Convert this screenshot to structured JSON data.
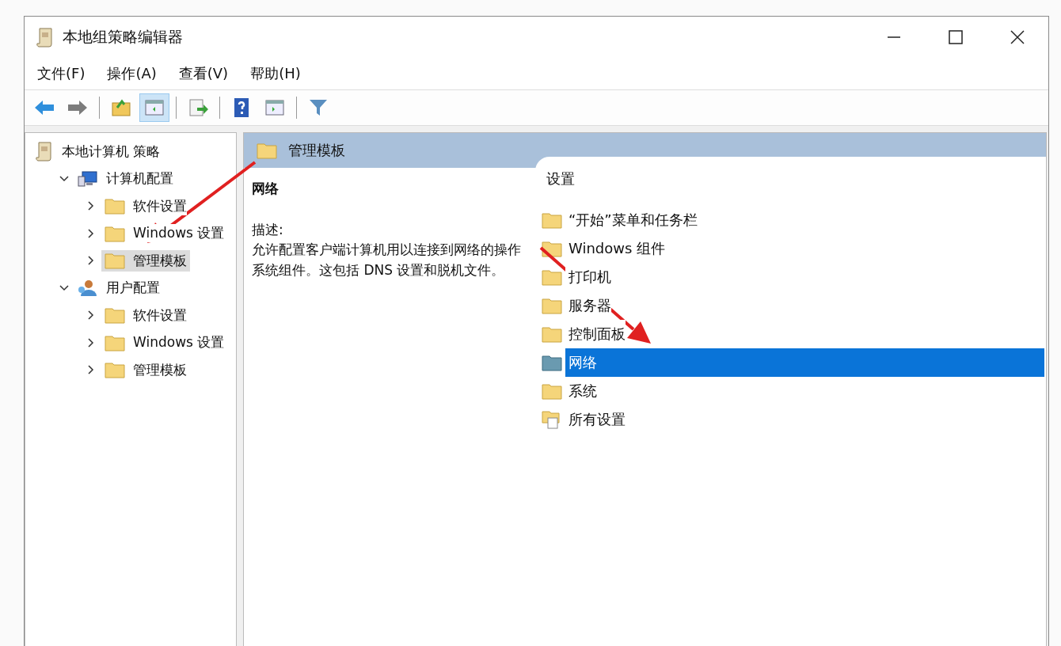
{
  "window": {
    "title": "本地组策略编辑器"
  },
  "menu": [
    "文件(F)",
    "操作(A)",
    "查看(V)",
    "帮助(H)"
  ],
  "toolbar": [
    [
      {
        "kind": "back",
        "pressed": false
      },
      {
        "kind": "forward",
        "pressed": false
      }
    ],
    [
      {
        "kind": "up",
        "pressed": false
      },
      {
        "kind": "tree",
        "pressed": true
      }
    ],
    [
      {
        "kind": "export",
        "pressed": false
      }
    ],
    [
      {
        "kind": "help",
        "pressed": false
      },
      {
        "kind": "pane",
        "pressed": false
      }
    ],
    [
      {
        "kind": "filter",
        "pressed": false
      }
    ]
  ],
  "tree": {
    "label": "本地计算机 策略",
    "kind": "policy",
    "selected": false,
    "children": [
      {
        "label": "计算机配置",
        "kind": "computer",
        "expanded": true,
        "selected": false,
        "children": [
          {
            "label": "软件设置",
            "kind": "folder",
            "expanded": false,
            "selected": false
          },
          {
            "label": "Windows 设置",
            "kind": "folder",
            "expanded": false,
            "selected": false
          },
          {
            "label": "管理模板",
            "kind": "folder",
            "expanded": false,
            "selected": true
          }
        ]
      },
      {
        "label": "用户配置",
        "kind": "user",
        "expanded": true,
        "selected": false,
        "children": [
          {
            "label": "软件设置",
            "kind": "folder",
            "expanded": false,
            "selected": false
          },
          {
            "label": "Windows 设置",
            "kind": "folder",
            "expanded": false,
            "selected": false
          },
          {
            "label": "管理模板",
            "kind": "folder",
            "expanded": false,
            "selected": false
          }
        ]
      }
    ]
  },
  "details": {
    "header": "管理模板",
    "item_title": "网络",
    "description_label": "描述:",
    "description": "允许配置客户端计算机用以连接到网络的操作系统组件。这包括 DNS 设置和脱机文件。",
    "column": "设置",
    "items": [
      {
        "label": "“开始”菜单和任务栏",
        "kind": "folder",
        "selected": false
      },
      {
        "label": "Windows 组件",
        "kind": "folder",
        "selected": false
      },
      {
        "label": "打印机",
        "kind": "folder",
        "selected": false
      },
      {
        "label": "服务器",
        "kind": "folder",
        "selected": false
      },
      {
        "label": "控制面板",
        "kind": "folder",
        "selected": false
      },
      {
        "label": "网络",
        "kind": "folder",
        "selected": true
      },
      {
        "label": "系统",
        "kind": "folder",
        "selected": false
      },
      {
        "label": "所有设置",
        "kind": "settings",
        "selected": false
      }
    ]
  }
}
